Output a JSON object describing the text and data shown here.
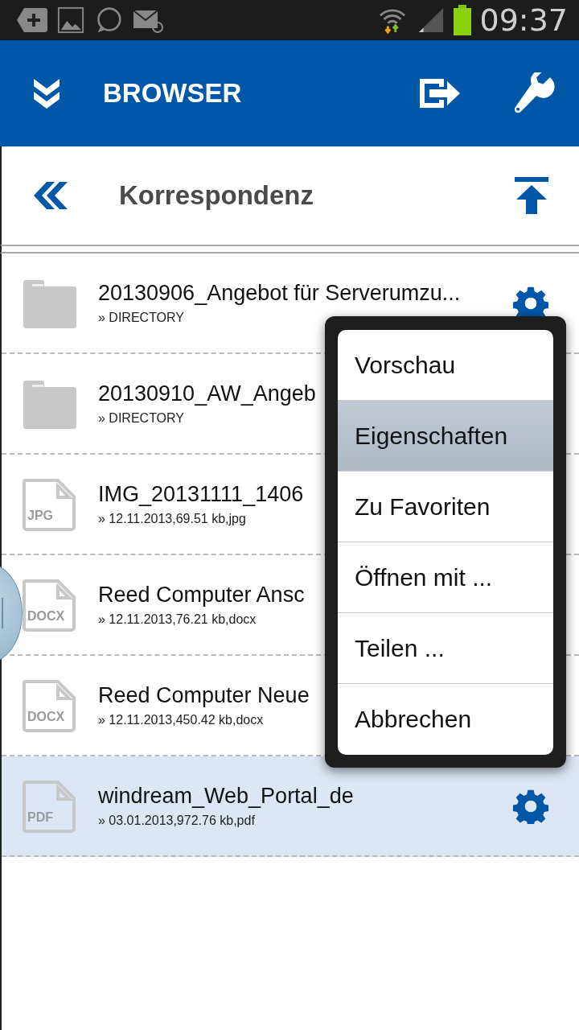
{
  "status_bar": {
    "time": "09:37"
  },
  "app_bar": {
    "title": "BROWSER"
  },
  "folder_bar": {
    "title": "Korrespondenz"
  },
  "files": [
    {
      "kind": "folder",
      "name": "20130906_Angebot für Serverumzu...",
      "details": "» DIRECTORY",
      "gear": true,
      "selected": false
    },
    {
      "kind": "folder",
      "name": "20130910_AW_Angeb",
      "details": "» DIRECTORY",
      "gear": false,
      "selected": false
    },
    {
      "kind": "file",
      "badge": "JPG",
      "name": "IMG_20131111_1406",
      "details": "» 12.11.2013,69.51 kb,jpg",
      "gear": false,
      "selected": false
    },
    {
      "kind": "file",
      "badge": "DOCX",
      "name": "Reed Computer Ansc",
      "details": "» 12.11.2013,76.21 kb,docx",
      "gear": false,
      "selected": false
    },
    {
      "kind": "file",
      "badge": "DOCX",
      "name": "Reed Computer Neue",
      "details": "» 12.11.2013,450.42 kb,docx",
      "gear": false,
      "selected": false
    },
    {
      "kind": "file",
      "badge": "PDF",
      "name": "windream_Web_Portal_de",
      "details": "» 03.01.2013,972.76 kb,pdf",
      "gear": true,
      "selected": true
    }
  ],
  "context_menu": {
    "items": [
      {
        "label": "Vorschau",
        "selected": false
      },
      {
        "label": "Eigenschaften",
        "selected": true
      },
      {
        "label": "Zu Favoriten",
        "selected": false
      },
      {
        "label": "Öffnen mit ...",
        "selected": false
      },
      {
        "label": "Teilen ...",
        "selected": false
      },
      {
        "label": "Abbrechen",
        "selected": false
      }
    ]
  }
}
